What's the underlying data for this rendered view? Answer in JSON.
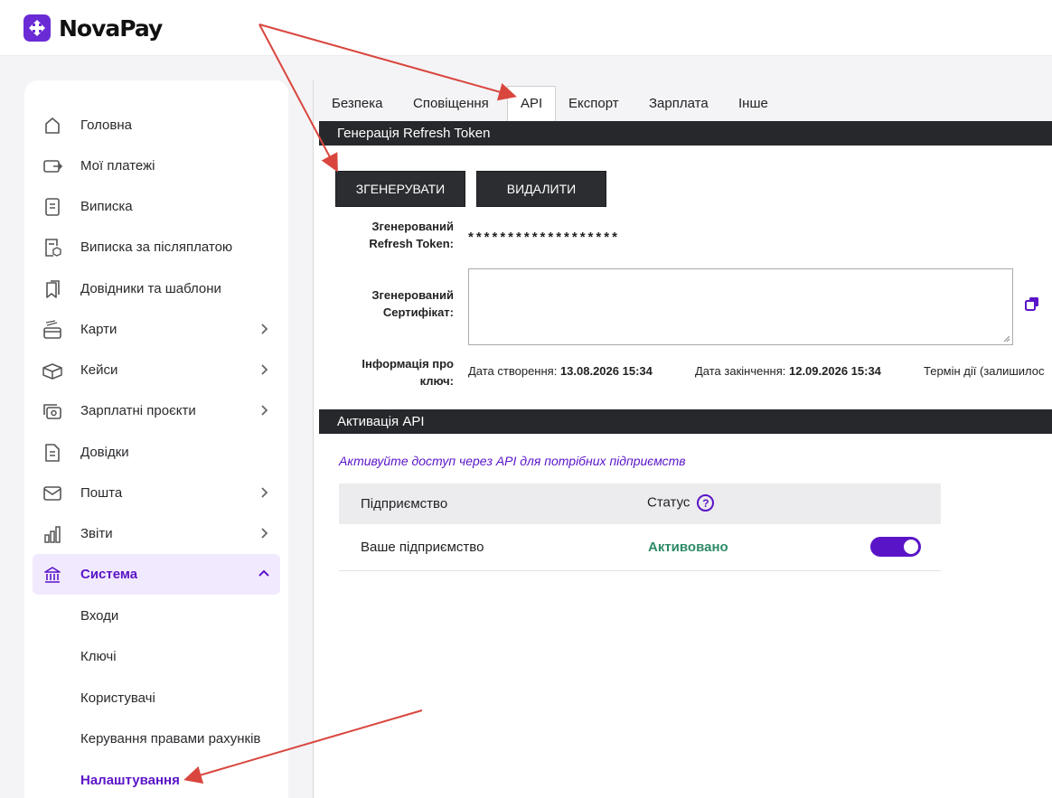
{
  "brand": {
    "name": "NovaPay",
    "accent": "#5a14c8",
    "logo_color": "#6a2bd6"
  },
  "sidebar": {
    "items": [
      {
        "label": "Головна",
        "icon": "home-icon"
      },
      {
        "label": "Мої платежі",
        "icon": "wallet-icon"
      },
      {
        "label": "Виписка",
        "icon": "document-icon"
      },
      {
        "label": "Виписка за післяплатою",
        "icon": "statement-box-icon"
      },
      {
        "label": "Довідники та шаблони",
        "icon": "bookmark-icon"
      },
      {
        "label": "Карти",
        "icon": "card-icon"
      },
      {
        "label": "Кейси",
        "icon": "case-icon"
      },
      {
        "label": "Зарплатні проєкти",
        "icon": "salary-icon"
      },
      {
        "label": "Довідки",
        "icon": "certificate-icon"
      },
      {
        "label": "Пошта",
        "icon": "mail-icon"
      },
      {
        "label": "Звіти",
        "icon": "chart-icon"
      },
      {
        "label": "Система",
        "icon": "bank-icon"
      }
    ],
    "subitems": [
      {
        "label": "Входи"
      },
      {
        "label": "Ключі"
      },
      {
        "label": "Користувачі"
      },
      {
        "label": "Керування правами рахунків"
      },
      {
        "label": "Налаштування"
      }
    ]
  },
  "tabs": [
    {
      "label": "Безпека"
    },
    {
      "label": "Сповіщення"
    },
    {
      "label": "API"
    },
    {
      "label": "Експорт"
    },
    {
      "label": "Зарплата"
    },
    {
      "label": "Інше"
    }
  ],
  "token_section": {
    "title": "Генерація Refresh Token",
    "generate_label": "ЗГЕНЕРУВАТИ",
    "delete_label": "ВИДАЛИТИ",
    "token_label_1": "Згенерований",
    "token_label_2": "Refresh Token:",
    "token_value": "*******************",
    "cert_label_1": "Згенерований",
    "cert_label_2": "Сертифікат:",
    "cert_value": "",
    "info_label_1": "Інформація про",
    "info_label_2": "ключ:",
    "created_label": "Дата створення:",
    "created_value": "13.08.2026 15:34",
    "expires_label": "Дата закінчення:",
    "expires_value": "12.09.2026 15:34",
    "term_label": "Термін дії (залишилос"
  },
  "api_section": {
    "title": "Активація API",
    "hint": "Активуйте доступ через API для потрібних підприємств",
    "col_company": "Підприємство",
    "col_status": "Статус",
    "rows": [
      {
        "company": "Ваше підприємство",
        "status": "Активовано",
        "enabled": true
      }
    ],
    "status_color": "#2e8b67"
  }
}
